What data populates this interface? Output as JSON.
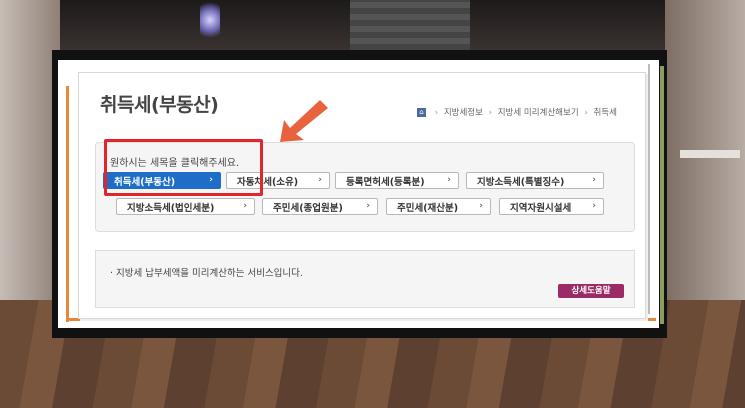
{
  "page": {
    "title": "취득세(부동산)",
    "breadcrumb": [
      "지방세정보",
      "지방세 미리계산해보기",
      "취득세"
    ],
    "instruction": "원하시는 세목을 클릭해주세요.",
    "info_text": "· 지방세 납부세액을 미리계산하는 서비스입니다.",
    "help_label": "상세도움말"
  },
  "tax_buttons": {
    "b0": "취득세(부동산)",
    "b1": "자동차세(소유)",
    "b2": "등록면허세(등록분)",
    "b3": "지방소득세(특별징수)",
    "b4": "지방소득세(법인세분)",
    "b5": "주민세(종업원분)",
    "b6": "주민세(재산분)",
    "b7": "지역자원시설세"
  },
  "icons": {
    "home": "home-icon",
    "chevron": "chevron-right-icon",
    "arrow": "arrow-pointer-icon"
  },
  "colors": {
    "active_button": "#1e6ec8",
    "highlight_box": "#e0262a",
    "arrow": "#e8623d",
    "help_button": "#9b2b66"
  }
}
